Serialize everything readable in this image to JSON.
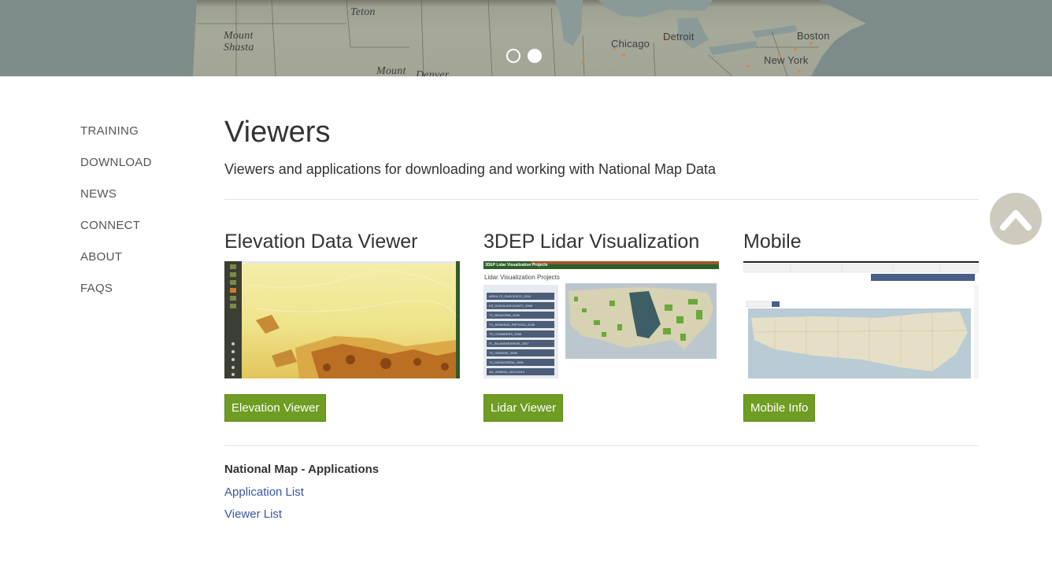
{
  "hero": {
    "cities": [
      "Teton",
      "Mount Shasta",
      "Mount",
      "Denver",
      "Chicago",
      "Detroit",
      "Boston",
      "New York"
    ],
    "slide_count": 2,
    "active_slide": 2
  },
  "nav": {
    "items": [
      "TRAINING",
      "DOWNLOAD",
      "NEWS",
      "CONNECT",
      "ABOUT",
      "FAQS"
    ]
  },
  "main": {
    "title": "Viewers",
    "subtitle": "Viewers and applications for downloading and working with National Map Data"
  },
  "cards": [
    {
      "title": "Elevation Data Viewer",
      "button": "Elevation Viewer"
    },
    {
      "title": "3DEP Lidar Visualization",
      "button": "Lidar Viewer",
      "thumb_header": "3DEP Lidar Visualization Projects",
      "thumb_heading": "Lidar Visualization Projects",
      "thumb_items": [
        "ARRA-TX_SUECESCO_2010",
        "KS_DOUGLASCOUNTY_2008",
        "TX_BRAZORIA_2006",
        "TX_ARANSAS_REFUGIO_2006",
        "TX_CHAMBERS_2006",
        "FL_INLANDMONROE_2007",
        "TX_ORANGE_2006",
        "TX_MATAGORDA_2006",
        "AK_JUNEAU_2013-2014"
      ]
    },
    {
      "title": "Mobile",
      "button": "Mobile Info"
    }
  ],
  "apps": {
    "heading": "National Map - Applications",
    "links": [
      "Application List",
      "Viewer List"
    ]
  },
  "colors": {
    "button_green": "#6f9c22",
    "link_blue": "#3a55a8",
    "text": "#333333"
  }
}
